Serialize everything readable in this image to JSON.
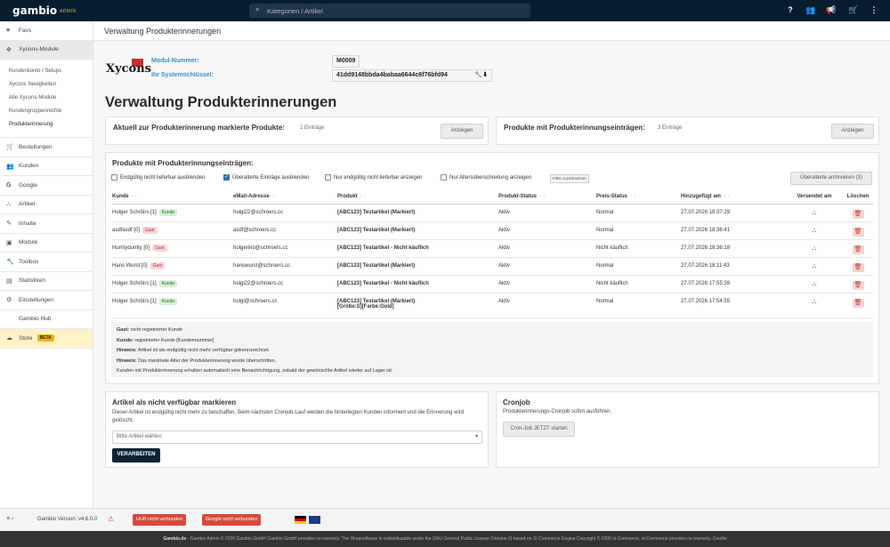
{
  "app": {
    "logo": "gambio",
    "logo_sub": "ADMIN"
  },
  "search": {
    "placeholder": "Kategorien / Artikel"
  },
  "topbar_icons": [
    "help-icon",
    "users-icon",
    "megaphone-icon",
    "cart-icon",
    "user-menu-icon"
  ],
  "sidebar": {
    "items_top": [
      {
        "label": "Favs",
        "icon": "heart-icon"
      },
      {
        "label": "Xycons-Module",
        "icon": "puzzle-icon"
      }
    ],
    "sub": [
      "Kundenkonto / Setups",
      "Xycons Neuigkeiten",
      "Alle Xycons-Module",
      "Kundengruppenrechte",
      "Produkterinnerung"
    ],
    "items": [
      {
        "label": "Bestellungen",
        "icon": "cart-icon"
      },
      {
        "label": "Kunden",
        "icon": "users-icon"
      },
      {
        "label": "Google",
        "icon": "google-icon"
      },
      {
        "label": "Artikel",
        "icon": "sitemap-icon"
      },
      {
        "label": "Inhalte",
        "icon": "content-icon"
      },
      {
        "label": "Module",
        "icon": "module-icon"
      },
      {
        "label": "Toolbox",
        "icon": "wrench-icon"
      },
      {
        "label": "Statistiken",
        "icon": "chart-icon"
      },
      {
        "label": "Einstellungen",
        "icon": "gear-icon"
      },
      {
        "label": "Gambio Hub",
        "icon": "hub-icon"
      }
    ],
    "store": {
      "label": "Store",
      "badge": "BETA"
    }
  },
  "page": {
    "breadcrumb_title": "Verwaltung Produkterinnerungen",
    "xycons_logo": "Xycons",
    "modul_label": "Modul-Nummer:",
    "modul_value": "M0009",
    "key_label": "Ihr Systemschlüssel:",
    "key_value": "41dd9148bbda4babaa6644c6f76bfd94",
    "heading": "Verwaltung Produkterinnerungen"
  },
  "card_marked": {
    "title": "Aktuell zur Produkterinnerung markierte Produkte:",
    "count": "1 Einträge",
    "button": "Anzeigen"
  },
  "card_entries": {
    "title": "Produkte mit Produkterinnungseinträgen:",
    "count": "3 Einträge",
    "button": "Anzeigen"
  },
  "list": {
    "title": "Produkte mit Produkterinnungseinträgen:",
    "filters": [
      {
        "label": "Endgültig nicht lieferbar ausblenden",
        "checked": false
      },
      {
        "label": "Überalterte Einträge ausblenden",
        "checked": true
      },
      {
        "label": "Nur endgültig nicht lieferbar anzeigen",
        "checked": false
      },
      {
        "label": "Nur Altersüberschreitung anzeigen",
        "checked": false
      }
    ],
    "filter_reset": "Filter zurücksetzen",
    "archive_button": "Überalterte archivieren (3)",
    "columns": [
      "Kunde",
      "eMail-Adresse",
      "Produkt",
      "Produkt-Status",
      "Preis-Status",
      "Hinzugefügt am",
      "Versendet am",
      "Löschen"
    ],
    "rows": [
      {
        "kunde": "Holger Schröirs [1]",
        "tag": "Kunde",
        "email": "holgi22@schroers.cc",
        "produkt": "[ABC123] Testartikel (Markiert)",
        "produkt2": "",
        "pstatus": "Aktiv",
        "preis": "Normal",
        "datum": "27.07.2026 18:37:29"
      },
      {
        "kunde": "asdfasdf [0]",
        "tag": "Gast",
        "email": "asdf@schroers.cc",
        "produkt": "[ABC123] Testartikel (Markiert)",
        "produkt2": "",
        "pstatus": "Aktiv",
        "preis": "Normal",
        "datum": "27.07.2026 18:36:41"
      },
      {
        "kunde": "Humtydumty [0]",
        "tag": "Gast",
        "email": "holgerino@schroers.cc",
        "produkt": "[ABC123] Testartikel - Nicht käuflich",
        "produkt2": "",
        "pstatus": "Aktiv",
        "preis": "Nicht käuflich",
        "datum": "27.07.2026 18:36:18"
      },
      {
        "kunde": "Hans Wurst [0]",
        "tag": "Gast",
        "email": "hanswurst@schroers.cc",
        "produkt": "[ABC123] Testartikel (Markiert)",
        "produkt2": "",
        "pstatus": "Aktiv",
        "preis": "Normal",
        "datum": "27.07.2026 18:11:43"
      },
      {
        "kunde": "Holger Schröirs [1]",
        "tag": "Kunde",
        "email": "holgi22@schroers.cc",
        "produkt": "[ABC123] Testartikel - Nicht käuflich",
        "produkt2": "",
        "pstatus": "Aktiv",
        "preis": "Nicht käuflich",
        "datum": "27.07.2026 17:55:39"
      },
      {
        "kunde": "Holger Schröirs [1]",
        "tag": "Kunde",
        "email": "holgi@schroers.cc",
        "produkt": "[ABC123] Testartikel (Markiert)",
        "produkt2": "[Größe:S][Farbe:Gold]",
        "pstatus": "Aktiv",
        "preis": "Normal",
        "datum": "27.07.2026 17:54:55"
      }
    ]
  },
  "legend": [
    {
      "b": "Gast:",
      "t": " nicht registrierter Kunde"
    },
    {
      "b": "Kunde:",
      "t": " registrierter Kunde [Kundennummer]"
    },
    {
      "b": "Hinweis:",
      "t": " Artikel ist als endgültig nicht mehr verfügbar gekennzeichnet."
    },
    {
      "b": "Hinweis:",
      "t": " Das maximale Alter der Produkterinnerung wurde überschritten."
    },
    {
      "b": "",
      "t": "Kunden mit Produkterinnerung erhalten automatisch eine Benachrichtigung, sobald der gewünschte Artikel wieder auf Lager ist."
    }
  ],
  "unavailable": {
    "title": "Artikel als nicht verfügbar markieren",
    "text": "Dieser Artikel ist endgültig nicht mehr zu beschaffen. Beim nächsten Cronjob-Lauf werden die hinterlegten Kunden informiert und die Erinnerung wird gelöscht.",
    "select_placeholder": "Bitte Artikel wählen",
    "button": "VERARBEITEN"
  },
  "cronjob": {
    "title": "Cronjob",
    "text": "Produkterinnerungs-Cronjob sofort ausführen.",
    "button": "Cron-Job JETZT starten"
  },
  "footer": {
    "version": "Gambio Version: v4.6.0.0",
    "hub": "HUB nicht verbunden",
    "google": "Google nicht verbunden",
    "copyright_pre": "Gambio.de",
    "copyright": " - Gambio Admin © 2020 Gambio GmbH Gambio GmbH provides no warranty. The Shopsoftware is redistributable under the GNU General Public License (Version 2) based on: E-Commerce Engine Copyright © 2006 xt:Commerce, xt:Commerce provides no warranty.   Credits"
  }
}
